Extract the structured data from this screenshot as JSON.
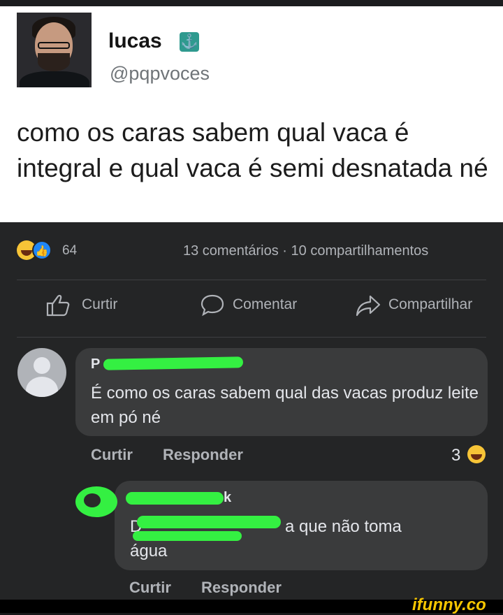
{
  "tweet": {
    "name": "lucas",
    "emoji": "⚓",
    "handle": "@pqpvoces",
    "text": "como os caras sabem qual vaca é integral e qual vaca é semi desnatada né"
  },
  "post": {
    "reaction_count": "64",
    "stats": "13 comentários · 10 compartilhamentos",
    "actions": {
      "like": "Curtir",
      "comment": "Comentar",
      "share": "Compartilhar"
    }
  },
  "comments": [
    {
      "author": "P",
      "text": "É como os caras sabem qual das vacas produz leite em pó né",
      "like_label": "Curtir",
      "reply_label": "Responder",
      "reaction_count": "3"
    },
    {
      "author": "k",
      "text_start": "D",
      "text_end": "a que não toma",
      "text_line2": "água",
      "like_label": "Curtir",
      "reply_label": "Responder"
    }
  ],
  "watermark": "ifunny.co",
  "colors": {
    "fb_background": "#242526",
    "bubble": "#3a3b3c",
    "redaction": "#34f042",
    "like_blue": "#1f86f6",
    "haha_yellow": "#f7c437"
  }
}
